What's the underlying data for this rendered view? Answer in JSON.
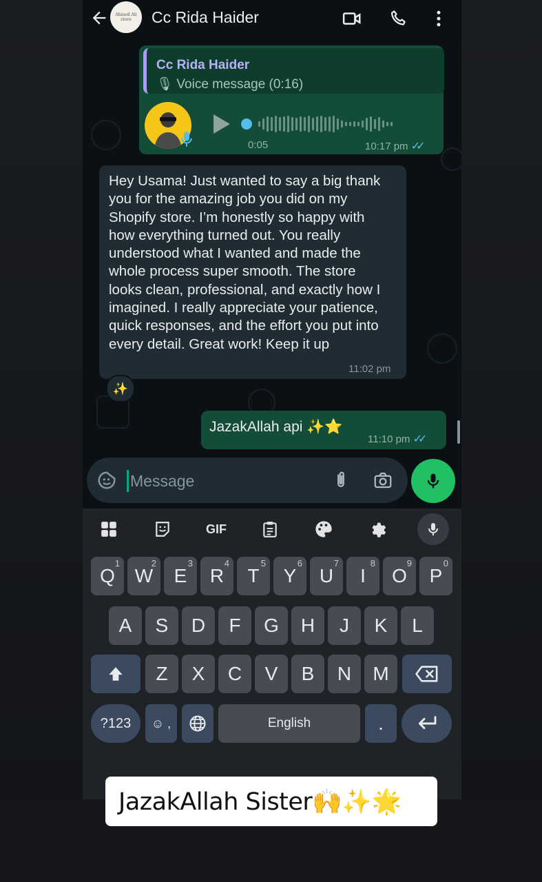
{
  "header": {
    "contact_name": "Cc Rida Haider",
    "avatar_text": "Ahmed Ali store"
  },
  "voice_message": {
    "quote_name": "Cc Rida Haider",
    "quote_sub": "Voice message (0:16)",
    "position": "0:05",
    "time": "10:17 pm"
  },
  "incoming_message": {
    "text": "Hey Usama! Just wanted to say a big thank you for the amazing job you did on my Shopify store. I’m honestly so happy with how everything turned out. You really understood what I wanted and made the whole process super smooth. The store looks clean, professional, and exactly how I imagined. I really appreciate your patience, quick responses, and the effort you put into every detail. Great work! Keep it up",
    "time": "11:02 pm",
    "reaction": "✨"
  },
  "outgoing_message": {
    "text": "JazakAllah api ✨⭐",
    "time": "11:10 pm"
  },
  "composer": {
    "placeholder": "Message"
  },
  "keyboard": {
    "toolbar": [
      "apps-grid-icon",
      "sticker-icon",
      "GIF",
      "clipboard-icon",
      "palette-icon",
      "gear-icon",
      "mic-icon"
    ],
    "row1": [
      "Q",
      "W",
      "E",
      "R",
      "T",
      "Y",
      "U",
      "I",
      "O",
      "P"
    ],
    "row1_hints": [
      "1",
      "2",
      "3",
      "4",
      "5",
      "6",
      "7",
      "8",
      "9",
      "0"
    ],
    "row2": [
      "A",
      "S",
      "D",
      "F",
      "G",
      "H",
      "J",
      "K",
      "L"
    ],
    "row3": [
      "Z",
      "X",
      "C",
      "V",
      "B",
      "N",
      "M"
    ],
    "symbols_label": "?123",
    "space_label": "English",
    "period_label": ".",
    "emoji_label": "☺ ,"
  },
  "caption": {
    "text": "JazakAllah Sister🙌✨🌟"
  },
  "colors": {
    "outgoing_bubble": "#144d37",
    "incoming_bubble": "#1f2c33",
    "accent_green": "#21c063",
    "read_ticks": "#53bdeb"
  }
}
